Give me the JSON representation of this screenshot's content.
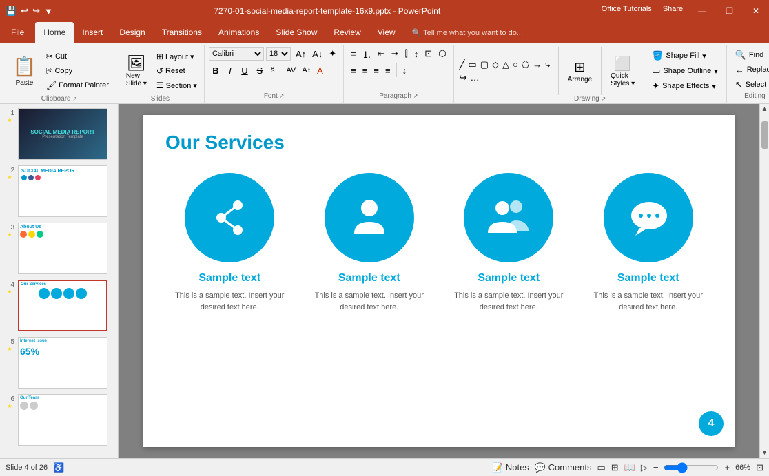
{
  "titlebar": {
    "filename": "7270-01-social-media-report-template-16x9.pptx - PowerPoint",
    "quick_access": [
      "save",
      "undo",
      "redo",
      "customize"
    ],
    "win_buttons": [
      "minimize",
      "restore",
      "close"
    ],
    "office_tutorials": "Office Tutorials",
    "share": "Share"
  },
  "tabs": [
    {
      "label": "File",
      "id": "file"
    },
    {
      "label": "Home",
      "id": "home",
      "active": true
    },
    {
      "label": "Insert",
      "id": "insert"
    },
    {
      "label": "Design",
      "id": "design"
    },
    {
      "label": "Transitions",
      "id": "transitions"
    },
    {
      "label": "Animations",
      "id": "animations"
    },
    {
      "label": "Slide Show",
      "id": "slideshow"
    },
    {
      "label": "Review",
      "id": "review"
    },
    {
      "label": "View",
      "id": "view"
    },
    {
      "label": "Tell me what you want to do...",
      "id": "help"
    }
  ],
  "ribbon": {
    "groups": [
      {
        "id": "clipboard",
        "label": "Clipboard",
        "items": [
          "Paste",
          "Cut",
          "Copy",
          "Format Painter"
        ]
      },
      {
        "id": "slides",
        "label": "Slides",
        "items": [
          "New Slide",
          "Layout",
          "Reset",
          "Section"
        ]
      },
      {
        "id": "font",
        "label": "Font",
        "items": [
          "Bold",
          "Italic",
          "Underline",
          "Strikethrough",
          "Shadow",
          "Font Color"
        ]
      },
      {
        "id": "paragraph",
        "label": "Paragraph",
        "items": [
          "Bullets",
          "Numbering",
          "Decrease Indent",
          "Increase Indent",
          "Align Left",
          "Center",
          "Align Right",
          "Justify"
        ]
      },
      {
        "id": "drawing",
        "label": "Drawing",
        "items": [
          "Shape",
          "Arrange",
          "Quick Styles",
          "Shape Fill",
          "Shape Outline",
          "Shape Effects"
        ]
      },
      {
        "id": "editing",
        "label": "Editing",
        "items": [
          "Find",
          "Replace",
          "Select"
        ]
      }
    ],
    "shape_fill": "Shape Fill",
    "shape_outline": "Shape Outline",
    "shape_effects": "Shape Effects",
    "quick_styles": "Quick Styles",
    "arrange": "Arrange",
    "find": "Find",
    "replace": "Replace",
    "select": "Select"
  },
  "slides": [
    {
      "num": 1,
      "starred": true,
      "type": "cover"
    },
    {
      "num": 2,
      "starred": true,
      "type": "report"
    },
    {
      "num": 3,
      "starred": true,
      "type": "about"
    },
    {
      "num": 4,
      "starred": true,
      "type": "services",
      "active": true
    },
    {
      "num": 5,
      "starred": true,
      "type": "internet"
    },
    {
      "num": 6,
      "starred": true,
      "type": "team"
    }
  ],
  "main_slide": {
    "title": "Our Services",
    "services": [
      {
        "icon": "share",
        "title": "Sample text",
        "desc": "This is a sample text. Insert your desired text here."
      },
      {
        "icon": "person",
        "title": "Sample text",
        "desc": "This is a sample text. Insert your desired text here."
      },
      {
        "icon": "group",
        "title": "Sample text",
        "desc": "This is a sample text. Insert your desired text here."
      },
      {
        "icon": "chat",
        "title": "Sample text",
        "desc": "This is a sample text. Insert your desired text here."
      }
    ],
    "page_number": "4"
  },
  "statusbar": {
    "slide_info": "Slide 4 of 26",
    "notes": "Notes",
    "comments": "Comments",
    "zoom": "66%"
  }
}
